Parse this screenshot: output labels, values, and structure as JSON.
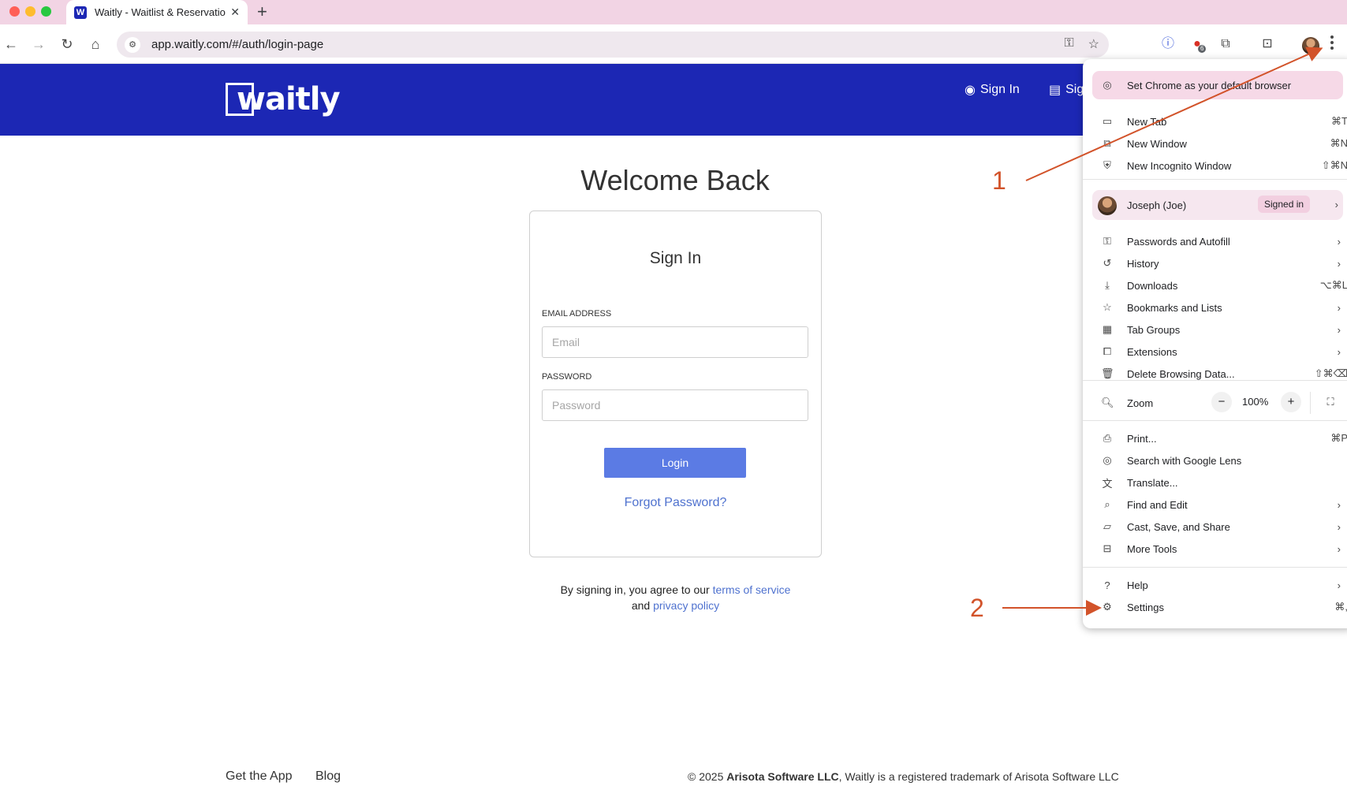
{
  "browser": {
    "tab_title": "Waitly - Waitlist & Reservation",
    "tab_favicon": "W",
    "url": "app.waitly.com/#/auth/login-page",
    "extension_badge": "6"
  },
  "header": {
    "logo": "waitly",
    "links": [
      "Sign In",
      "Sig"
    ]
  },
  "login": {
    "welcome": "Welcome Back",
    "card_title": "Sign In",
    "email_label": "EMAIL ADDRESS",
    "email_placeholder": "Email",
    "password_label": "PASSWORD",
    "password_placeholder": "Password",
    "login_button": "Login",
    "forgot": "Forgot Password?",
    "terms_prefix": "By signing in, you agree to our",
    "terms_link": "terms of service",
    "and": "and",
    "privacy_link": "privacy policy"
  },
  "footer": {
    "links": [
      "Get the App",
      "Blog"
    ],
    "copyright_prefix": "© 2025",
    "company": "Arisota Software LLC",
    "copyright_suffix": ", Waitly is a registered trademark of Arisota Software LLC"
  },
  "annotations": [
    "1",
    "2"
  ],
  "menu": {
    "banner": "Set Chrome as your default browser",
    "group1": [
      {
        "label": "New Tab",
        "shortcut": "⌘T",
        "icon": "new-tab-icon"
      },
      {
        "label": "New Window",
        "shortcut": "⌘N",
        "icon": "new-window-icon"
      },
      {
        "label": "New Incognito Window",
        "shortcut": "⇧⌘N",
        "icon": "incognito-icon"
      }
    ],
    "profile": {
      "name": "Joseph (Joe)",
      "status": "Signed in"
    },
    "group2": [
      {
        "label": "Passwords and Autofill",
        "shortcut": "",
        "icon": "key-icon",
        "submenu": true
      },
      {
        "label": "History",
        "shortcut": "",
        "icon": "history-icon",
        "submenu": true
      },
      {
        "label": "Downloads",
        "shortcut": "⌥⌘L",
        "icon": "download-icon",
        "submenu": false
      },
      {
        "label": "Bookmarks and Lists",
        "shortcut": "",
        "icon": "star-icon",
        "submenu": true
      },
      {
        "label": "Tab Groups",
        "shortcut": "",
        "icon": "grid-icon",
        "submenu": true
      },
      {
        "label": "Extensions",
        "shortcut": "",
        "icon": "puzzle-icon",
        "submenu": true
      },
      {
        "label": "Delete Browsing Data...",
        "shortcut": "⇧⌘⌫",
        "icon": "trash-icon",
        "submenu": false
      }
    ],
    "zoom": {
      "label": "Zoom",
      "minus": "−",
      "value": "100%",
      "plus": "+"
    },
    "group3": [
      {
        "label": "Print...",
        "shortcut": "⌘P",
        "icon": "print-icon",
        "submenu": false
      },
      {
        "label": "Search with Google Lens",
        "shortcut": "",
        "icon": "lens-icon",
        "submenu": false
      },
      {
        "label": "Translate...",
        "shortcut": "",
        "icon": "translate-icon",
        "submenu": false
      },
      {
        "label": "Find and Edit",
        "shortcut": "",
        "icon": "find-icon",
        "submenu": true
      },
      {
        "label": "Cast, Save, and Share",
        "shortcut": "",
        "icon": "cast-icon",
        "submenu": true
      },
      {
        "label": "More Tools",
        "shortcut": "",
        "icon": "toolbox-icon",
        "submenu": true
      }
    ],
    "group4": [
      {
        "label": "Help",
        "shortcut": "",
        "icon": "help-icon",
        "submenu": true
      },
      {
        "label": "Settings",
        "shortcut": "⌘,",
        "icon": "gear-icon",
        "submenu": false
      }
    ]
  },
  "colors": {
    "header_bg": "#1c27b4",
    "button_bg": "#5b7be4",
    "link": "#4f72cf",
    "annotation": "#d2532a",
    "tabbar_bg": "#f2d4e4"
  }
}
